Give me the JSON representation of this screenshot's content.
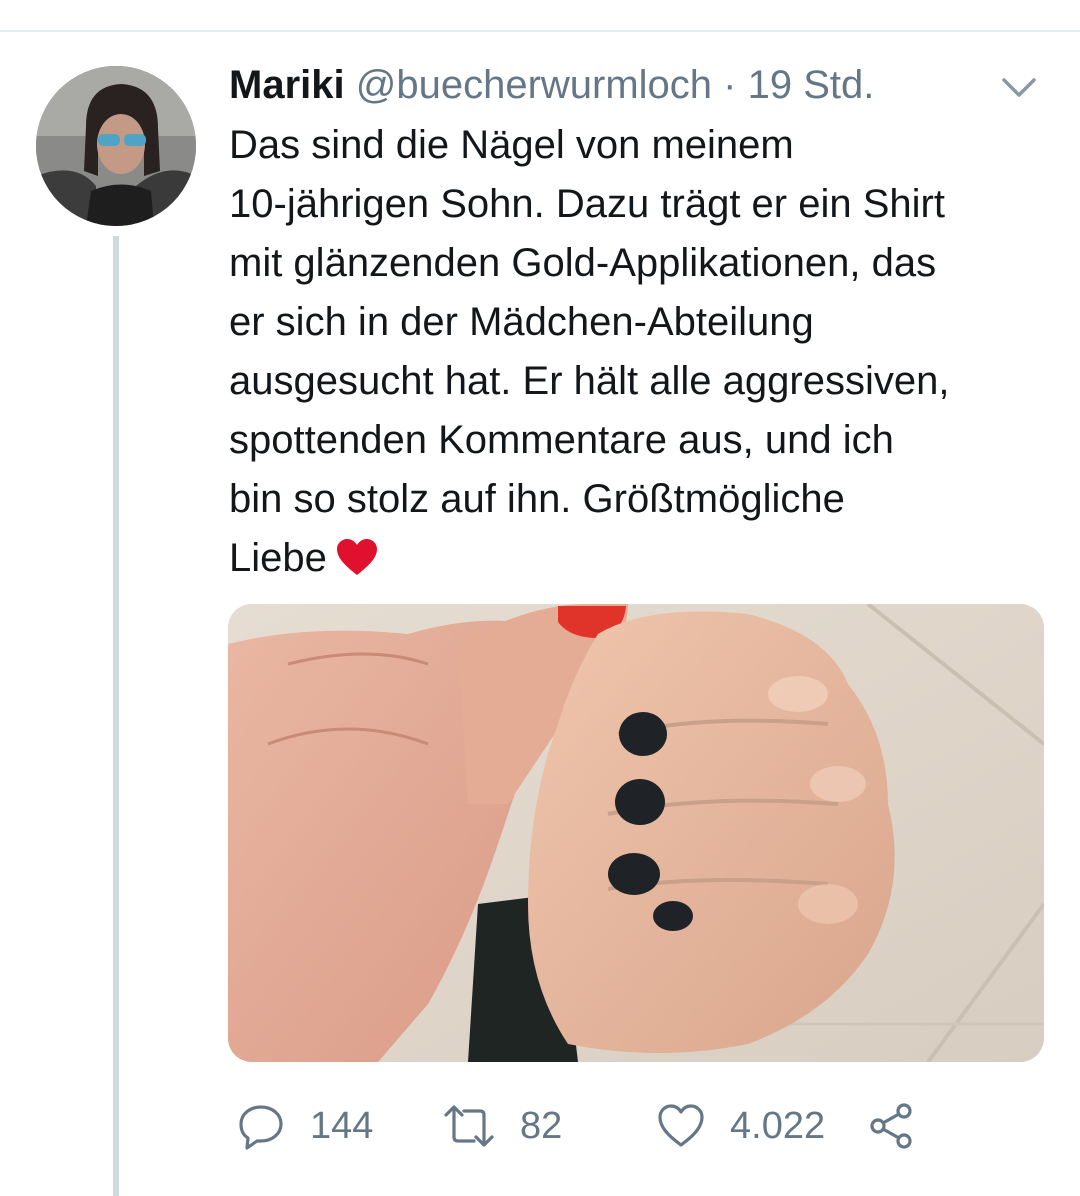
{
  "tweet": {
    "author_name": "Mariki",
    "handle": "@buecherwurmloch",
    "separator": "·",
    "time": "19 Std.",
    "text_lines": [
      "Das sind die Nägel von meinem",
      "10-jährigen Sohn. Dazu trägt er ein Shirt",
      "mit glänzenden Gold-Applikationen, das",
      "er sich in der Mädchen-Abteilung",
      "ausgesucht hat. Er hält alle aggressiven,",
      "spottenden Kommentare aus, und ich",
      "bin so stolz auf ihn. Größtmögliche",
      "Liebe"
    ],
    "emoji": "red-heart-emoji"
  },
  "actions": {
    "reply_count": "144",
    "retweet_count": "82",
    "like_count": "4.022"
  },
  "icons": {
    "reply": "reply-icon",
    "retweet": "retweet-icon",
    "like": "like-icon",
    "share": "share-icon",
    "more": "chevron-down-icon"
  },
  "colors": {
    "text": "#14171a",
    "secondary": "#657786",
    "heart": "#e0112f",
    "thread_line": "#cfd9de"
  }
}
